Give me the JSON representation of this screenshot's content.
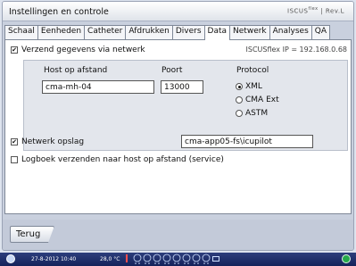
{
  "window": {
    "title": "Instellingen en controle",
    "brand": "ISCUS",
    "brand_sup": "flex",
    "brand_suffix": "Rev.L"
  },
  "tabs": [
    "Schaal",
    "Eenheden",
    "Catheter",
    "Afdrukken",
    "Divers",
    "Data",
    "Netwerk",
    "Analyses",
    "QA"
  ],
  "active_tab": "Data",
  "panel": {
    "send_data_label": "Verzend gegevens via netwerk",
    "send_data_checked": true,
    "ip_info": "ISCUSflex IP = 192.168.0.68",
    "host_label": "Host op afstand",
    "host_value": "cma-mh-04",
    "port_label": "Poort",
    "port_value": "13000",
    "protocol_label": "Protocol",
    "protocols": [
      {
        "label": "XML",
        "selected": true
      },
      {
        "label": "CMA Ext",
        "selected": false
      },
      {
        "label": "ASTM",
        "selected": false
      }
    ],
    "network_storage_label": "Netwerk opslag",
    "network_storage_checked": true,
    "network_storage_value": "cma-app05-fs\\icupilot",
    "log_label": "Logboek verzenden naar host op afstand (service)",
    "log_checked": false
  },
  "footer": {
    "back_label": "Terug"
  },
  "status": {
    "datetime": "27-8-2012 10:40",
    "temperature": "28,0 °C"
  },
  "icons": {
    "power": "power-icon",
    "thermometer": "thermometer-icon",
    "pumps": "pump-status-icons",
    "device": "device-icon",
    "network": "network-icon"
  }
}
